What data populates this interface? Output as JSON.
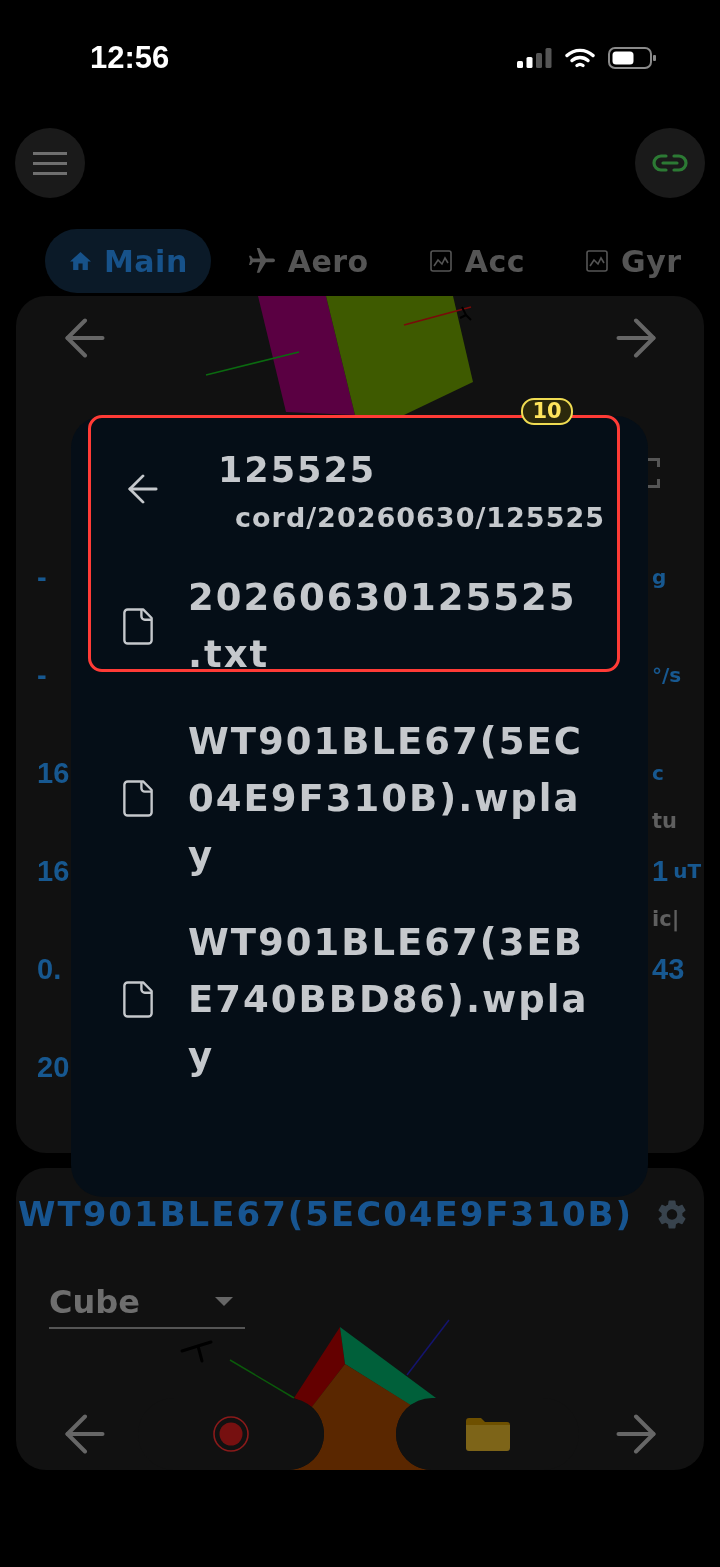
{
  "status_bar": {
    "time": "12:56"
  },
  "tabs": [
    {
      "label": "Main",
      "selected": true
    },
    {
      "label": "Aero",
      "selected": false
    },
    {
      "label": "Acc",
      "selected": false
    },
    {
      "label": "Gyr",
      "selected": false
    }
  ],
  "sensor_card": {
    "readings": [
      {
        "left": {
          "value": "-"
        },
        "right": {
          "unit": "g"
        }
      },
      {
        "left": {
          "value": "-"
        },
        "right": {
          "unit": "°/s"
        }
      },
      {
        "left": {
          "value": "16"
        },
        "right": {
          "unit": "c",
          "label": "tu"
        }
      },
      {
        "left": {
          "value": "16"
        },
        "right": {
          "value": "1",
          "unit": "uT",
          "label": "ic|"
        }
      },
      {
        "left": {
          "value": "0."
        },
        "right": {
          "value": "43"
        }
      },
      {
        "left": {
          "value": "20"
        }
      }
    ]
  },
  "device_card": {
    "title": "WT901BLE67(5EC04E9F310B)",
    "view_select": {
      "value": "Cube"
    }
  },
  "file_dialog": {
    "title": "125525",
    "path": "cord/20260630/125525",
    "files": [
      {
        "name": "20260630125525.txt"
      },
      {
        "name": "WT901BLE67(5EC04E9F310B).wplay"
      },
      {
        "name": "WT901BLE67(3EBE740BBD86).wplay"
      }
    ]
  },
  "annotation": {
    "label": "10"
  }
}
